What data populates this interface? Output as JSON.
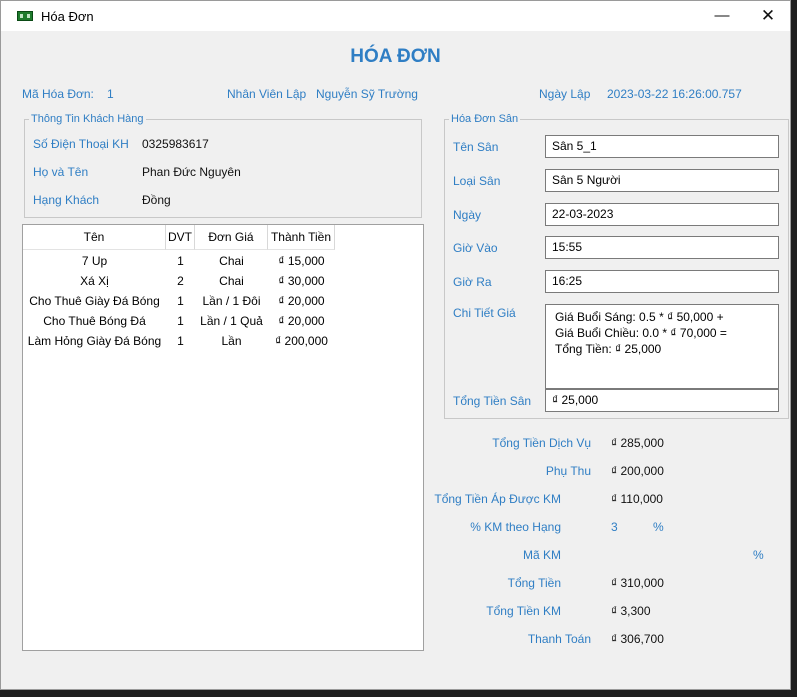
{
  "window": {
    "title": "Hóa Đơn",
    "minimize_label": "—",
    "close_label": "✕",
    "icon": "app-icon"
  },
  "heading": "HÓA ĐƠN",
  "info": {
    "invoice_id_label": "Mã Hóa Đơn:",
    "invoice_id": "1",
    "staff_label": "Nhân Viên Lập",
    "staff": "Nguyễn Sỹ Trường",
    "date_label": "Ngày Lập",
    "date": "2023-03-22 16:26:00.757"
  },
  "customer": {
    "legend": "Thông Tin Khách Hàng",
    "phone_label": "Số Điện Thoại KH",
    "phone": "0325983617",
    "name_label": "Họ và Tên",
    "name": "Phan Đức Nguyên",
    "rank_label": "Hạng Khách",
    "rank": "Đồng"
  },
  "items_table": {
    "headers": [
      "Tên",
      "DVT",
      "Đơn Giá",
      "Thành Tiền"
    ],
    "rows": [
      [
        "7 Up",
        "1",
        "Chai",
        "₫ 15,000"
      ],
      [
        "Xá Xị",
        "2",
        "Chai",
        "₫ 30,000"
      ],
      [
        "Cho Thuê Giày Đá Bóng",
        "1",
        "Lần / 1 Đôi",
        "₫ 20,000"
      ],
      [
        "Cho Thuê Bóng Đá",
        "1",
        "Lần / 1 Quả",
        "₫ 20,000"
      ],
      [
        "Làm Hỏng Giày Đá Bóng",
        "1",
        "Lần",
        "₫ 200,000"
      ]
    ]
  },
  "court": {
    "legend": "Hóa Đơn Sân",
    "name_label": "Tên Sân",
    "name": "Sân 5_1",
    "type_label": "Loại Sân",
    "type": "Sân 5 Người",
    "date_label": "Ngày",
    "date": "22-03-2023",
    "in_label": "Giờ Vào",
    "in": "15:55",
    "out_label": "Giờ Ra",
    "out": "16:25",
    "detail_label": "Chi Tiết Giá",
    "detail_lines": [
      "Giá Buổi Sáng: 0.5 * ₫ 50,000 +",
      "Giá Buổi Chiều: 0.0 * ₫ 70,000 =",
      "Tổng Tiền: ₫ 25,000"
    ],
    "total_label": "Tổng Tiền Sân",
    "total": "₫ 25,000"
  },
  "summary": {
    "service_total_label": "Tổng Tiền Dịch Vụ",
    "service_total": "₫ 285,000",
    "surcharge_label": "Phụ Thu",
    "surcharge": "₫ 200,000",
    "discountable_label": "Tổng Tiền Áp Được KM",
    "discountable": "₫ 110,000",
    "rank_pct_label": "% KM theo Hạng",
    "rank_pct": "3",
    "rank_pct_unit": "%",
    "promo_code_label": "Mã KM",
    "promo_code": "",
    "promo_unit": "%",
    "total_label": "Tổng Tiền",
    "total": "₫ 310,000",
    "discount_label": "Tổng Tiền KM",
    "discount": "₫ 3,300",
    "pay_label": "Thanh Toán",
    "pay": "₫ 306,700"
  }
}
